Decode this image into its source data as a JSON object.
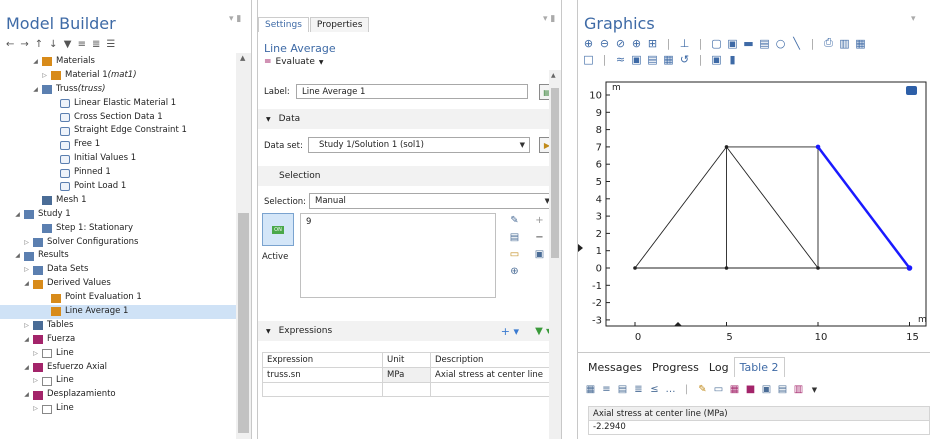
{
  "model_builder": {
    "title": "Model Builder",
    "tree": [
      {
        "label": "Materials",
        "italic": "",
        "level": 3,
        "expand": "open",
        "icon": "materials-icon",
        "color": "#d88b1a"
      },
      {
        "label": "Material 1 ",
        "italic": "(mat1)",
        "level": 4,
        "expand": "closed",
        "icon": "material-icon",
        "color": "#d88b1a"
      },
      {
        "label": "Truss ",
        "italic": "(truss)",
        "level": 3,
        "expand": "open",
        "icon": "truss-icon",
        "color": "#5b7fb0"
      },
      {
        "label": "Linear Elastic Material 1",
        "italic": "",
        "level": 5,
        "expand": "",
        "icon": "node-icon",
        "color": "#5b7fb0"
      },
      {
        "label": "Cross Section Data 1",
        "italic": "",
        "level": 5,
        "expand": "",
        "icon": "node-icon",
        "color": "#5b7fb0"
      },
      {
        "label": "Straight Edge Constraint 1",
        "italic": "",
        "level": 5,
        "expand": "",
        "icon": "node-icon",
        "color": "#5b7fb0"
      },
      {
        "label": "Free 1",
        "italic": "",
        "level": 5,
        "expand": "",
        "icon": "node-icon",
        "color": "#5b7fb0"
      },
      {
        "label": "Initial Values 1",
        "italic": "",
        "level": 5,
        "expand": "",
        "icon": "node-icon",
        "color": "#5b7fb0"
      },
      {
        "label": "Pinned 1",
        "italic": "",
        "level": 5,
        "expand": "",
        "icon": "node-icon",
        "color": "#5b7fb0"
      },
      {
        "label": "Point Load 1",
        "italic": "",
        "level": 5,
        "expand": "",
        "icon": "node-icon",
        "color": "#5b7fb0"
      },
      {
        "label": "Mesh 1",
        "italic": "",
        "level": 3,
        "expand": "",
        "icon": "mesh-icon",
        "color": "#4a6c96"
      },
      {
        "label": "Study 1",
        "italic": "",
        "level": 1,
        "expand": "open",
        "icon": "study-icon",
        "color": "#5b7fb0"
      },
      {
        "label": "Step 1: Stationary",
        "italic": "",
        "level": 3,
        "expand": "",
        "icon": "step-icon",
        "color": "#5b7fb0"
      },
      {
        "label": "Solver Configurations",
        "italic": "",
        "level": 2,
        "expand": "closed",
        "icon": "solver-icon",
        "color": "#5b7fb0"
      },
      {
        "label": "Results",
        "italic": "",
        "level": 1,
        "expand": "open",
        "icon": "results-icon",
        "color": "#5b7fb0"
      },
      {
        "label": "Data Sets",
        "italic": "",
        "level": 2,
        "expand": "closed",
        "icon": "datasets-icon",
        "color": "#5b7fb0"
      },
      {
        "label": "Derived Values",
        "italic": "",
        "level": 2,
        "expand": "open",
        "icon": "derived-icon",
        "color": "#d88b1a"
      },
      {
        "label": "Point Evaluation 1",
        "italic": "",
        "level": 4,
        "expand": "",
        "icon": "point-eval-icon",
        "color": "#d88b1a"
      },
      {
        "label": "Line Average 1",
        "italic": "",
        "level": 4,
        "expand": "",
        "icon": "line-avg-icon",
        "color": "#d88b1a",
        "selected": true
      },
      {
        "label": "Tables",
        "italic": "",
        "level": 2,
        "expand": "closed",
        "icon": "tables-icon",
        "color": "#4a6c96"
      },
      {
        "label": "Fuerza",
        "italic": "",
        "level": 2,
        "expand": "open",
        "icon": "plot-group-icon",
        "color": "#a3246a"
      },
      {
        "label": "Line",
        "italic": "",
        "level": 3,
        "expand": "closed",
        "icon": "line-plot-icon",
        "color": "#888888"
      },
      {
        "label": "Esfuerzo Axial",
        "italic": "",
        "level": 2,
        "expand": "open",
        "icon": "plot-group-icon",
        "color": "#a3246a"
      },
      {
        "label": "Line",
        "italic": "",
        "level": 3,
        "expand": "closed",
        "icon": "line-plot-icon",
        "color": "#888888"
      },
      {
        "label": "Desplazamiento",
        "italic": "",
        "level": 2,
        "expand": "open",
        "icon": "plot-group-icon",
        "color": "#a3246a"
      },
      {
        "label": "Line",
        "italic": "",
        "level": 3,
        "expand": "closed",
        "icon": "line-plot-icon",
        "color": "#888888"
      }
    ]
  },
  "settings": {
    "tabs": [
      "Settings",
      "Properties"
    ],
    "node_title": "Line Average",
    "evaluate_label": "Evaluate",
    "label_caption": "Label:",
    "label_value": "Line Average 1",
    "data_section": "Data",
    "dataset_caption": "Data set:",
    "dataset_value": "Study 1/Solution 1 (sol1)",
    "selection_section": "Selection",
    "selection_caption": "Selection:",
    "selection_value": "Manual",
    "selection_entity": "9",
    "toggle_text": "ON",
    "active_label": "Active",
    "expressions_section": "Expressions",
    "expr_headers": [
      "Expression",
      "Unit",
      "Description"
    ],
    "expr_rows": [
      {
        "expression": "truss.sn",
        "unit": "MPa",
        "description": "Axial stress at center line"
      }
    ]
  },
  "graphics": {
    "title": "Graphics",
    "y_unit": "m",
    "x_unit": "m",
    "x_ticks": [
      "0",
      "5",
      "10",
      "15"
    ],
    "y_ticks": [
      "10",
      "9",
      "8",
      "7",
      "6",
      "5",
      "4",
      "3",
      "2",
      "1",
      "0",
      "-1",
      "-2",
      "-3"
    ],
    "accent": "#1a1aff"
  },
  "bottom": {
    "tabs": [
      "Messages",
      "Progress",
      "Log",
      "Table 2"
    ],
    "column_header": "Axial stress at center line (MPa)",
    "value": "-2.2940"
  }
}
